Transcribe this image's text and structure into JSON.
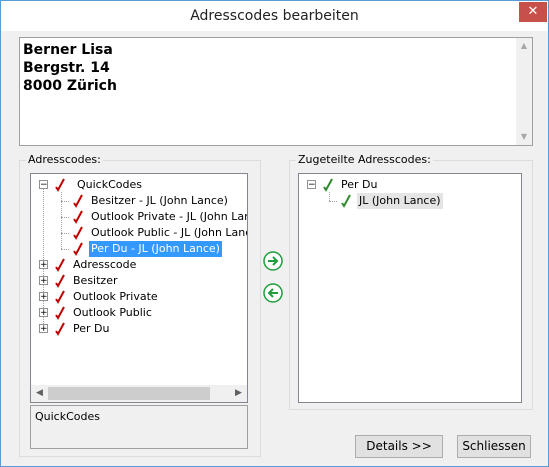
{
  "window": {
    "title": "Adresscodes bearbeiten",
    "close_symbol": "✕"
  },
  "address": {
    "lines": [
      "Berner Lisa",
      "Bergstr. 14",
      "8000 Zürich"
    ]
  },
  "left_panel": {
    "label": "Adresscodes:",
    "tree": [
      {
        "label": "QuickCodes",
        "expanded": true,
        "children": [
          {
            "label": "Besitzer - JL (John Lance)"
          },
          {
            "label": "Outlook Private - JL (John Lance)"
          },
          {
            "label": "Outlook Public - JL (John Lance)"
          },
          {
            "label": "Per Du - JL (John Lance)",
            "selected": true
          }
        ]
      },
      {
        "label": "Adresscode",
        "expanded": false
      },
      {
        "label": "Besitzer",
        "expanded": false
      },
      {
        "label": "Outlook Private",
        "expanded": false
      },
      {
        "label": "Outlook Public",
        "expanded": false
      },
      {
        "label": "Per Du",
        "expanded": false
      }
    ],
    "info_text": "QuickCodes"
  },
  "right_panel": {
    "label": "Zugeteilte Adresscodes:",
    "tree": [
      {
        "label": "Per Du",
        "expanded": true,
        "children": [
          {
            "label": "JL (John Lance)",
            "selected_inactive": true
          }
        ]
      }
    ]
  },
  "buttons": {
    "add_icon": "arrow-right-circle-icon",
    "remove_icon": "arrow-left-circle-icon",
    "details_label": "Details >>",
    "close_label": "Schliessen"
  },
  "colors": {
    "selection": "#3399ff",
    "tick_red": "#c00000",
    "tick_green": "#2e8b2e",
    "arrow_green": "#1e9e3a"
  }
}
